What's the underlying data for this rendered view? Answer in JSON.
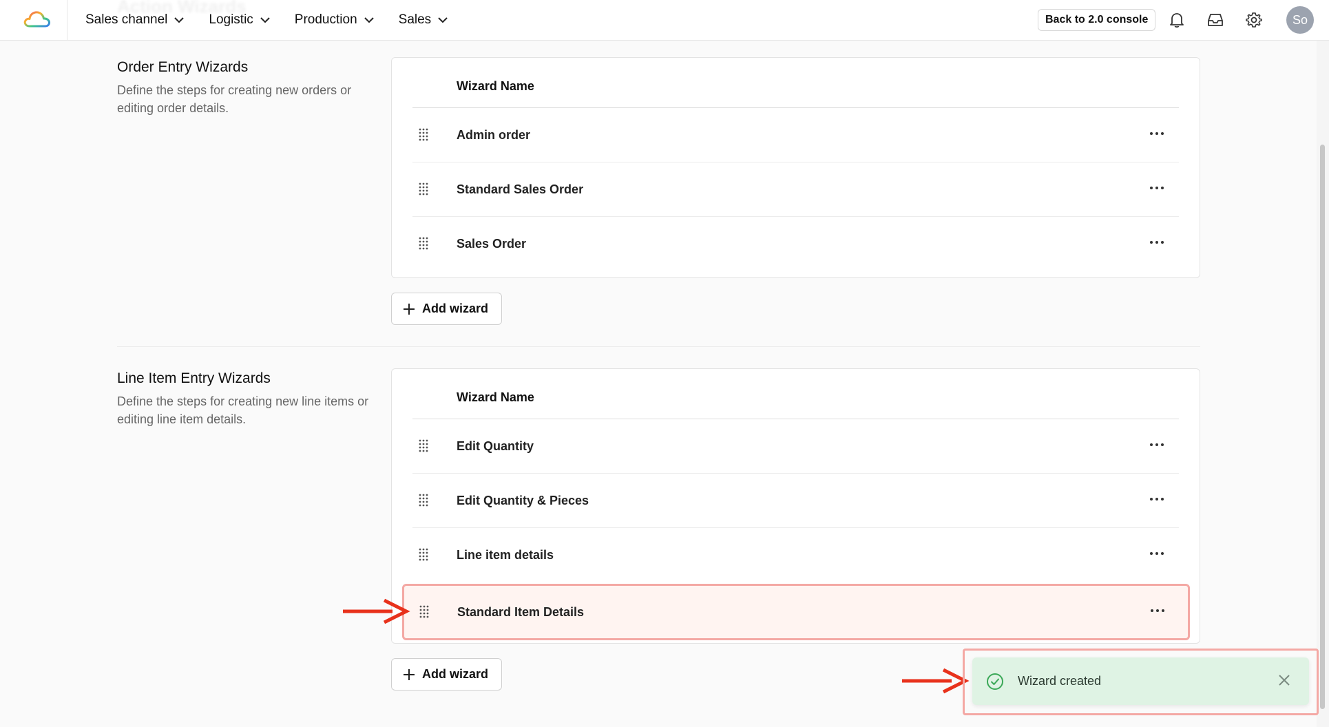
{
  "topbar": {
    "ghost_title": "Action Wizards",
    "nav": [
      {
        "label": "Sales channel"
      },
      {
        "label": "Logistic"
      },
      {
        "label": "Production"
      },
      {
        "label": "Sales"
      }
    ],
    "console_button": "Back to 2.0 console",
    "icons": [
      "bell-icon",
      "inbox-icon",
      "gear-icon"
    ],
    "avatar_initials": "So"
  },
  "order_section": {
    "title": "Order Entry Wizards",
    "description": "Define the steps for creating new orders or editing order details.",
    "column_header": "Wizard Name",
    "rows": [
      {
        "name": "Admin order"
      },
      {
        "name": "Standard Sales Order"
      },
      {
        "name": "Sales Order"
      }
    ],
    "add_button": "Add wizard"
  },
  "line_section": {
    "title": "Line Item Entry Wizards",
    "description": "Define the steps for creating new line items or editing line item details.",
    "column_header": "Wizard Name",
    "rows": [
      {
        "name": "Edit Quantity"
      },
      {
        "name": "Edit Quantity & Pieces"
      },
      {
        "name": "Line item details"
      },
      {
        "name": "Standard Item Details",
        "highlighted": true
      }
    ],
    "add_button": "Add wizard"
  },
  "toast": {
    "message": "Wizard created",
    "status": "success"
  },
  "colors": {
    "annotation_red": "#e8321c",
    "highlight_border": "#f4a8a4",
    "toast_bg": "#dff3e4",
    "toast_check": "#3aa857"
  }
}
